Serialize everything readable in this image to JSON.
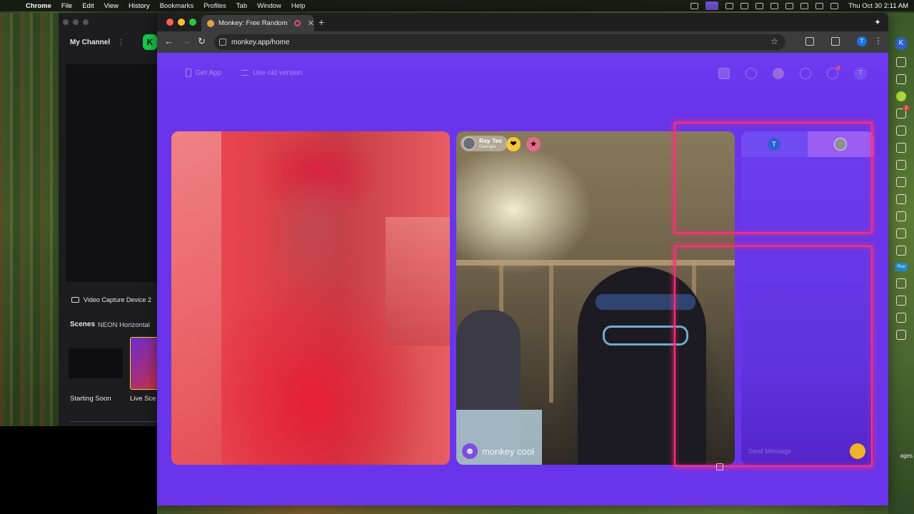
{
  "menubar": {
    "app": "Chrome",
    "menus": [
      "File",
      "Edit",
      "View",
      "History",
      "Bookmarks",
      "Profiles",
      "Tab",
      "Window",
      "Help"
    ],
    "clock": "Thu Oct 30  2:11 AM"
  },
  "obs": {
    "channel": "My Channel",
    "source_label": "Video Capture Device 2",
    "scenes_label": "Scenes",
    "scene_selector": "NEON Horizontal",
    "scenes": [
      "Starting Soon",
      "Live Sce"
    ]
  },
  "sidedock": {
    "profile_initial": "K",
    "notification_count": "2",
    "plus_label": "Plus",
    "pages_label": "ages"
  },
  "browser": {
    "tab_title": "Monkey: Free Random Vid",
    "url": "monkey.app/home",
    "profile_initial": "T"
  },
  "page": {
    "nav_left": [
      "Get App",
      "Use old version"
    ],
    "user_initial": "T",
    "partner": {
      "name": "Ray Tee",
      "location": "Georgia"
    },
    "watermark": "monkey cool",
    "chat": {
      "self_initial": "T",
      "input_placeholder": "Send Message"
    }
  },
  "colors": {
    "brand_purple": "#6a35ea",
    "neon_pink": "#ff2d7a"
  }
}
